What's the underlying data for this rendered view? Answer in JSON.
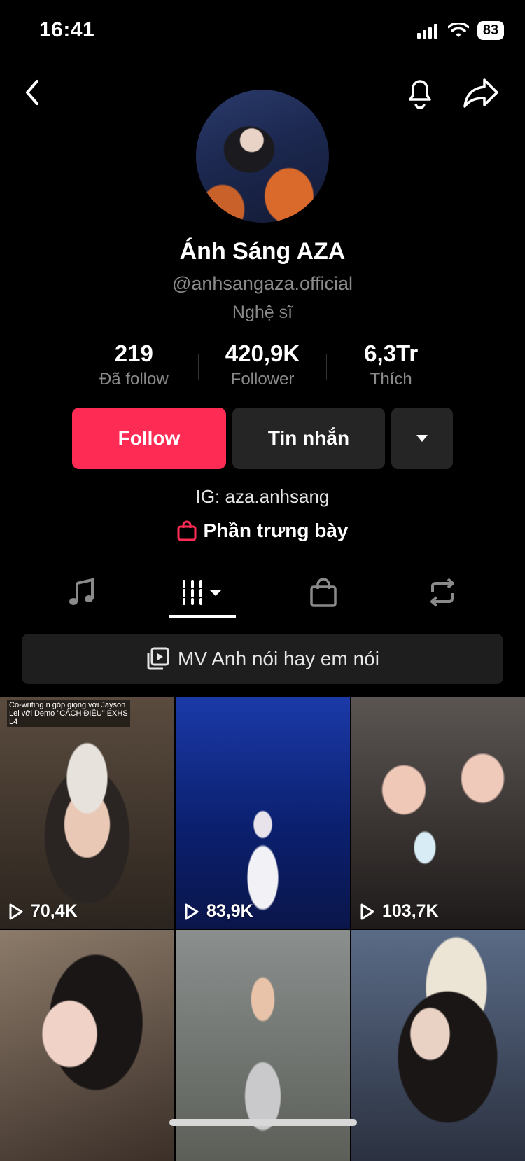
{
  "status_bar": {
    "time": "16:41",
    "battery": "83"
  },
  "profile": {
    "name": "Ánh Sáng AZA",
    "handle": "@anhsangaza.official",
    "category": "Nghệ sĩ",
    "bio": "IG: aza.anhsang",
    "showcase_label": "Phần trưng bày"
  },
  "stats": [
    {
      "value": "219",
      "label": "Đã follow"
    },
    {
      "value": "420,9K",
      "label": "Follower"
    },
    {
      "value": "6,3Tr",
      "label": "Thích"
    }
  ],
  "actions": {
    "follow": "Follow",
    "message": "Tin nhắn"
  },
  "tabs": [
    "music-icon",
    "videos-grid-icon",
    "shop-bag-icon",
    "repost-icon"
  ],
  "playlist": {
    "label": "MV Anh nói hay em nói"
  },
  "videos": [
    {
      "views": "70,4K",
      "caption": "Co-writing n góp giọng với Jayson Lei với Demo \"CÁCH ĐIỆU\" EXHS L4"
    },
    {
      "views": "83,9K",
      "caption": ""
    },
    {
      "views": "103,7K",
      "caption": ""
    },
    {
      "views": "",
      "caption": ""
    },
    {
      "views": "",
      "caption": ""
    },
    {
      "views": "",
      "caption": ""
    }
  ],
  "colors": {
    "accent": "#fe2c55",
    "button_dark": "#252525",
    "muted_text": "#8a8a8a"
  }
}
